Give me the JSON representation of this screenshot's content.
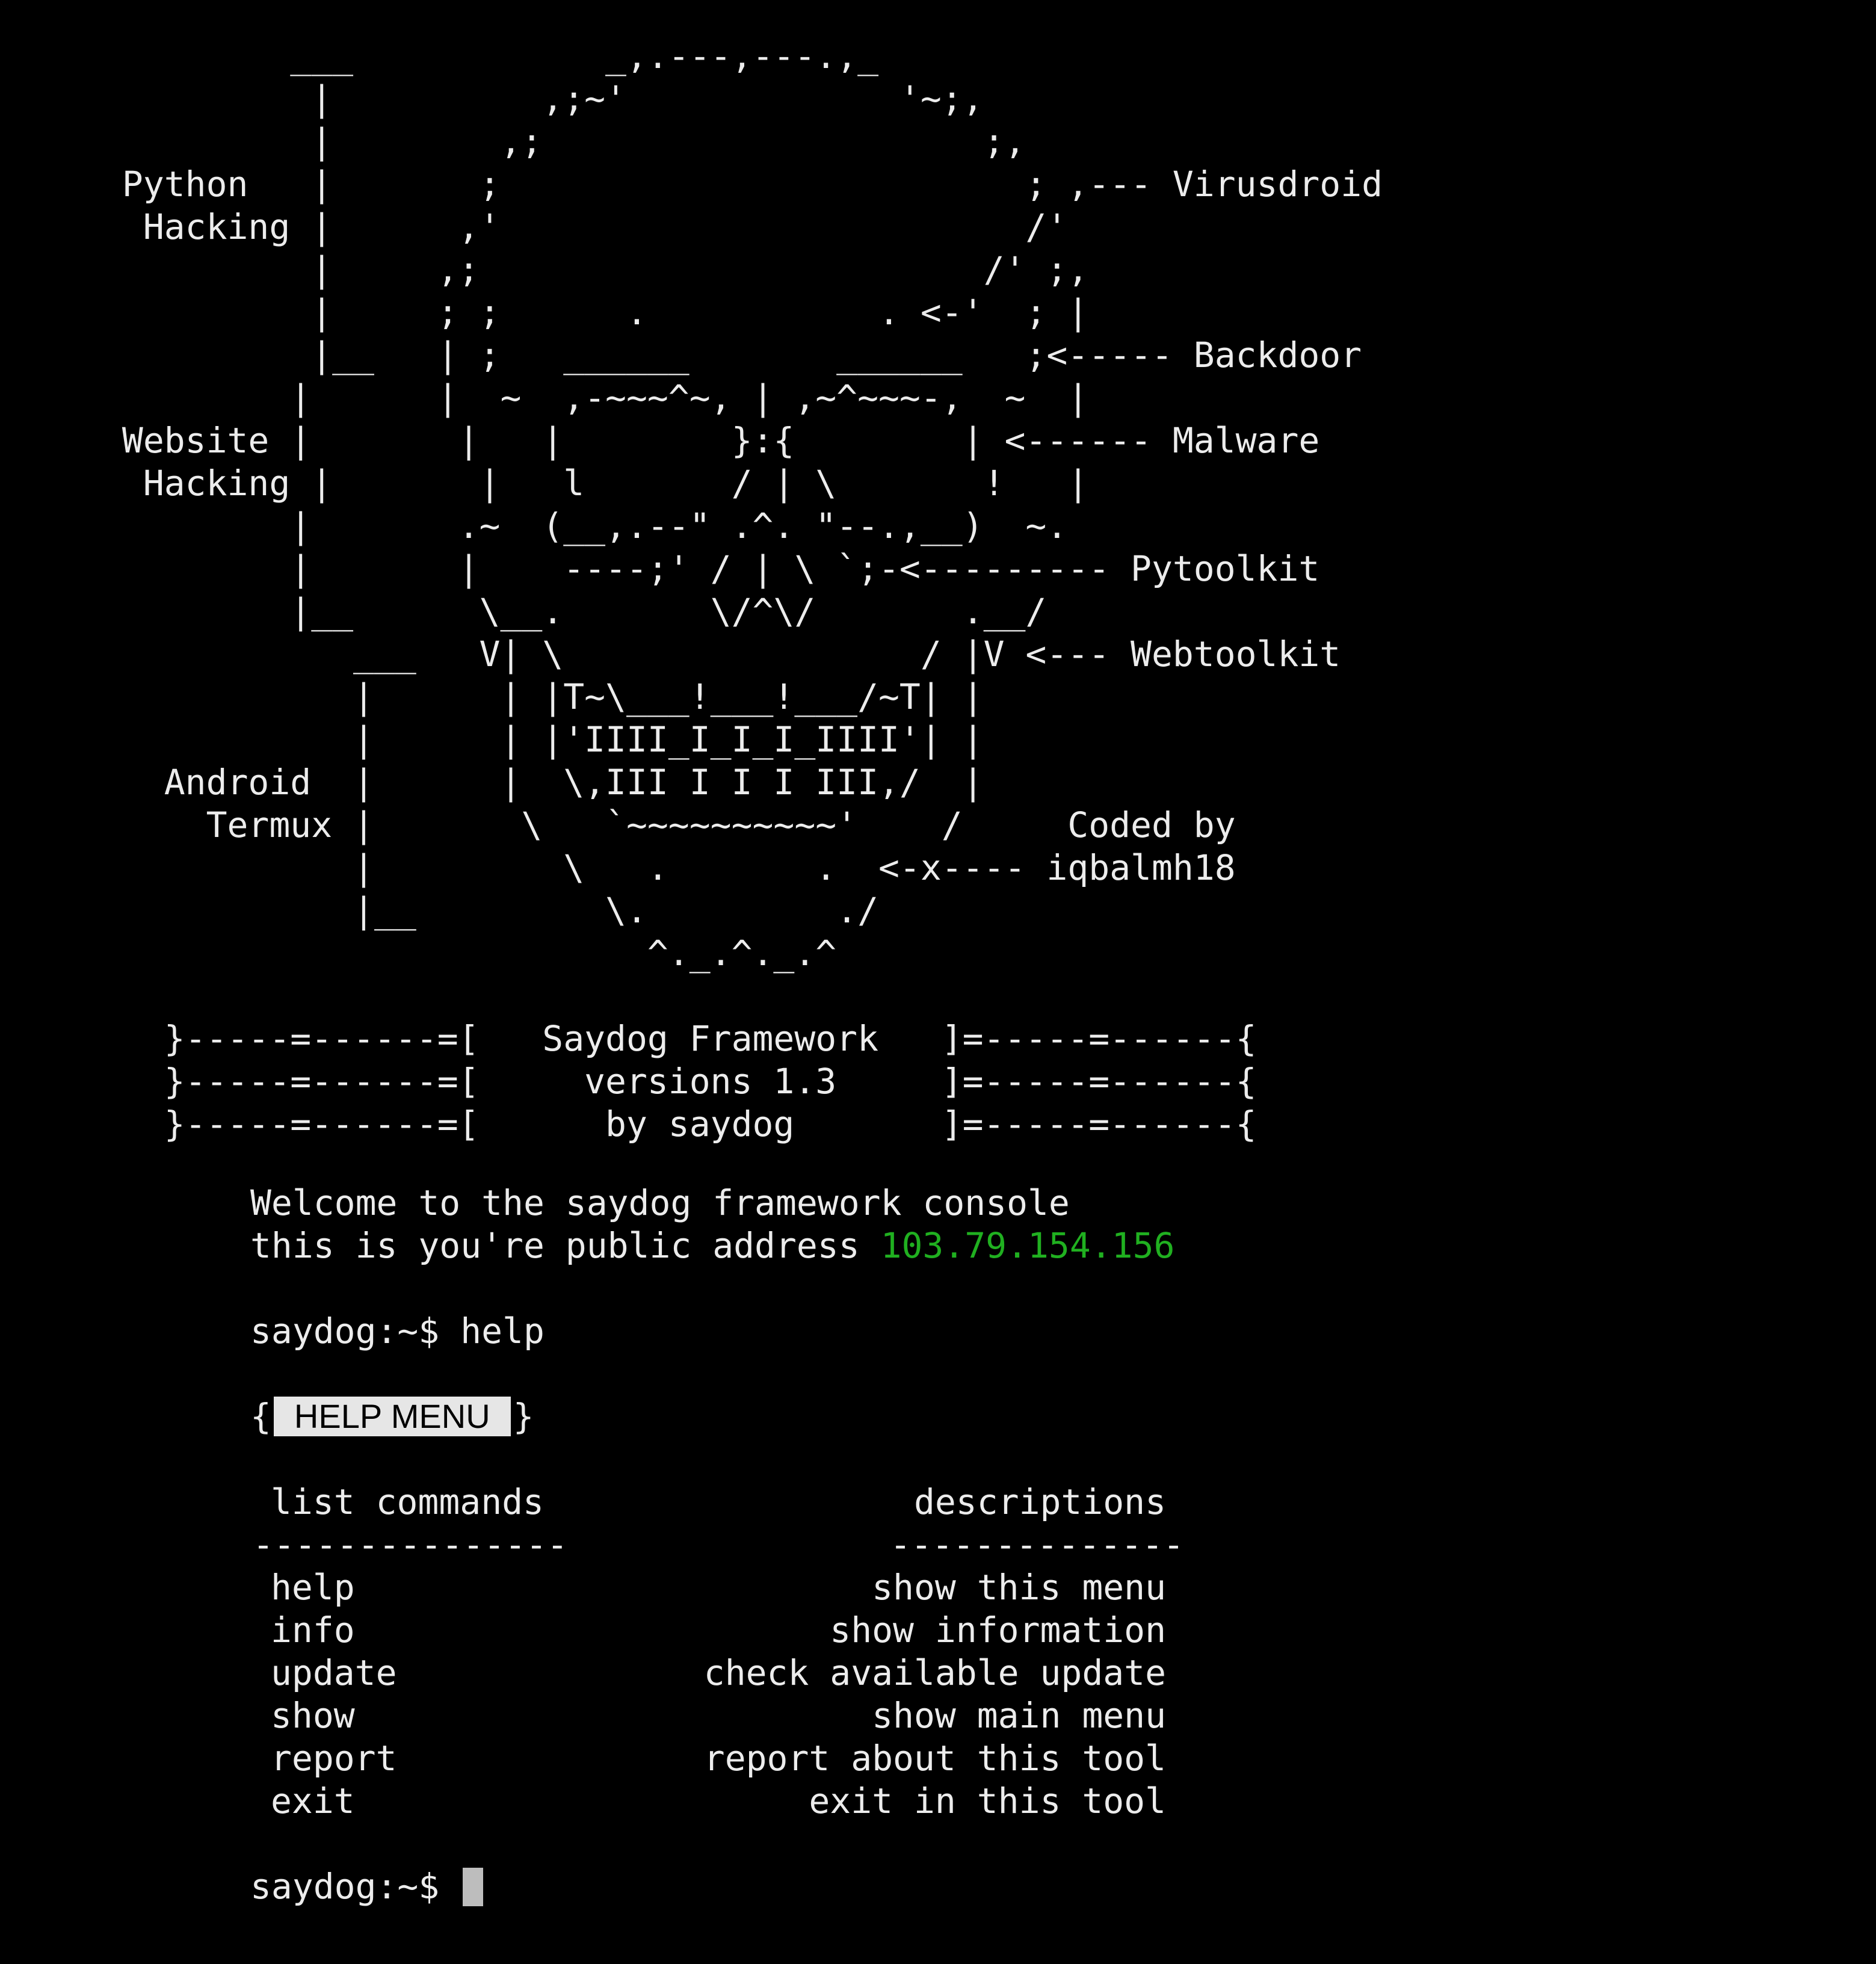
{
  "app": {
    "title": "Saydog Framework",
    "banner_art": "         ___            _,.---,---.,_\n          |          ,;~'             '~;,\n          |        ,;                     ;,\n Python   |       ;                         ; ,--- Virusdroid\n  Hacking |      ,'                         /'\n          |     ,;                        /' ;,\n          |     ; ;      .           . <-'  ; |\n          |__   | ;   ______       ______   ;<----- Backdoor\n         |      |  ~  ,-~~~^~, | ,~^~~~-,  ~  |\n Website |       |   |        }:{        | <------ Malware\n  Hacking |       |   l       / | \\       !   |\n         |       .~  (__,.--\" .^. \"--.,__)  ~.\n         |       |    ----;' / | \\ `;-<--------- Pytoolkit\n         |__      \\__.       \\/^\\/       .__/\n            ___   V| \\                 / |V <--- Webtoolkit\n            |      | |T~\\___!___!___/~T| |\n            |      | |'IIII_I_I_I_IIII'| |\n   Android  |      |  \\,III I I I III,/  |\n     Termux |       \\   `~~~~~~~~~~'    /     Coded by\n            |         \\   .       .  <-x---- iqbalmh18\n            |__         \\.         ./\n                          ^._.^._.^\n\n   }-----=------=[   Saydog Framework   ]=-----=------{\n   }-----=------=[     versions 1.3     ]=-----=------{\n   }-----=------=[      by saydog       ]=-----=------{"
  },
  "welcome": {
    "line1": "Welcome to the saydog framework console",
    "line2_prefix": "this is you're public address ",
    "ip": "103.79.154.156"
  },
  "session": {
    "prompt": "saydog:~$ ",
    "command": "help"
  },
  "help_menu": {
    "open_brace": "{",
    "title": "HELP MENU",
    "close_brace": "}",
    "header_left": "list commands",
    "header_right": "descriptions",
    "divider_left": "---------------",
    "divider_right": "--------------",
    "rows": [
      {
        "cmd": "help",
        "desc": "show this menu"
      },
      {
        "cmd": "info",
        "desc": "show information"
      },
      {
        "cmd": "update",
        "desc": "check available update"
      },
      {
        "cmd": "show",
        "desc": "show main menu"
      },
      {
        "cmd": "report",
        "desc": "report about this tool"
      },
      {
        "cmd": "exit",
        "desc": "exit in this tool"
      }
    ]
  },
  "final_prompt": "saydog:~$ ",
  "colors": {
    "background": "#000000",
    "text": "#ececec",
    "ip": "#20b020",
    "badge_bg": "#e6e6e6",
    "cursor": "#bdbdbd"
  }
}
